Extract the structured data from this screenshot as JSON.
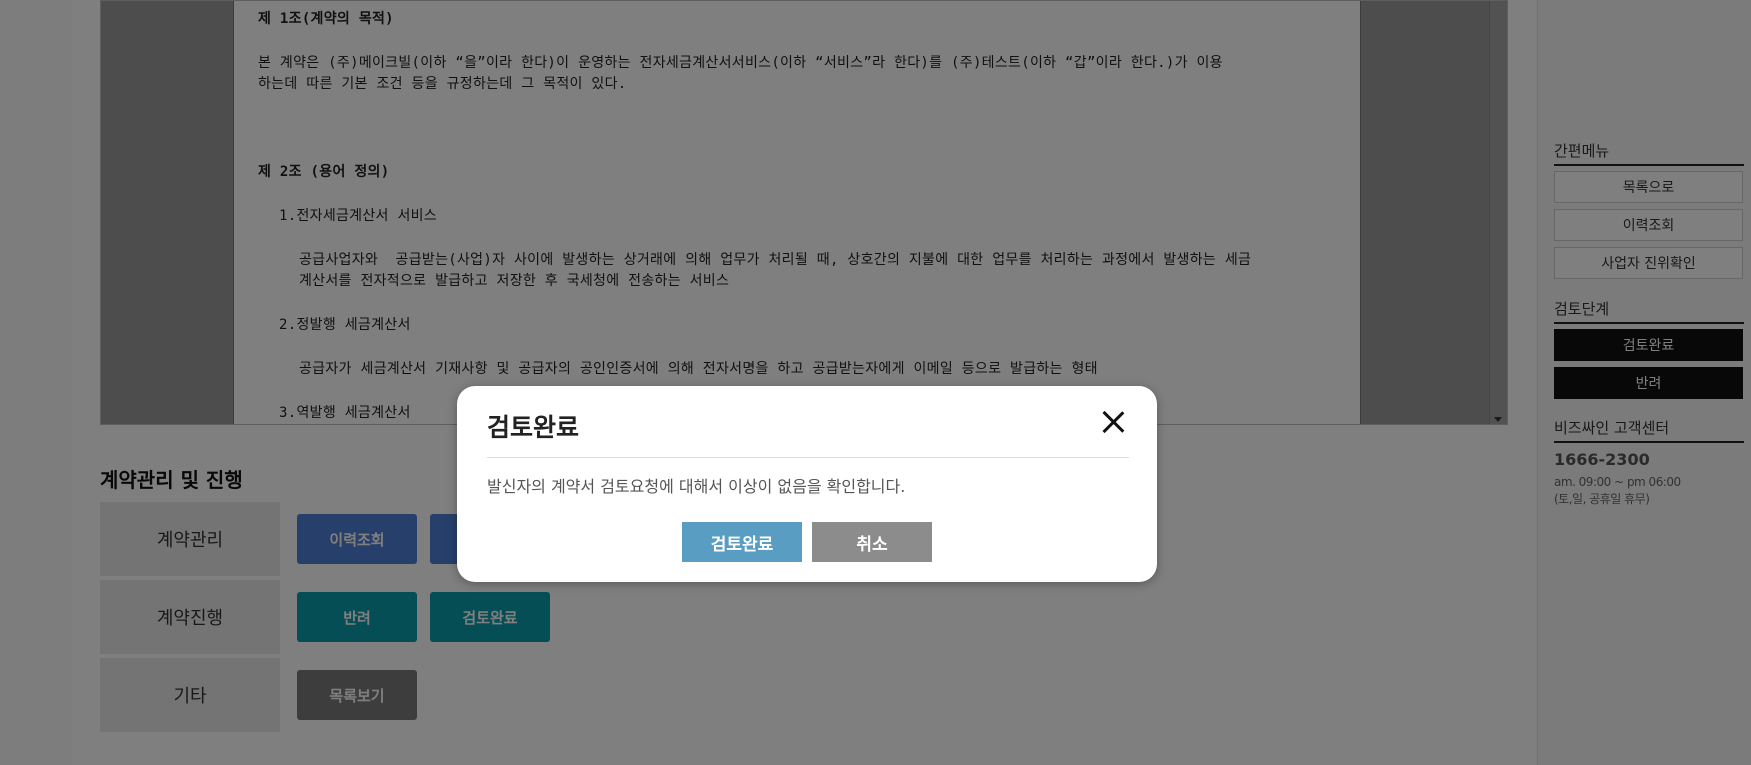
{
  "document": {
    "article1_title": "제 1조(계약의 목적)",
    "article1_line1": "본 계약은 (주)메이크빌(이하 “을”이라 한다)이 운영하는 전자세금계산서서비스(이하 “서비스”라 한다)를 (주)테스트(이하 “갑”이라 한다.)가 이용",
    "article1_line2": "하는데 따른 기본 조건 등을 규정하는데 그 목적이 있다.",
    "article2_title": "제 2조 (용어 정의)",
    "item1_title": "1.전자세금계산서 서비스",
    "item1_line1": "공급사업자와  공급받는(사업)자 사이에 발생하는 상거래에 의해 업무가 처리될 때, 상호간의 지불에 대한 업무를 처리하는 과정에서 발생하는 세금",
    "item1_line2": "계산서를 전자적으로 발급하고 저장한 후 국세청에 전송하는 서비스",
    "item2_title": "2.정발행 세금계산서",
    "item2_line1": "공급자가 세금계산서 기재사항 및 공급자의 공인인증서에 의해 전자서명을 하고 공급받는자에게 이메일 등으로 발급하는 형태",
    "item3_title": "3.역발행 세금계산서"
  },
  "management": {
    "section_title": "계약관리 및 진행",
    "rows": [
      {
        "label": "계약관리",
        "buttons": [
          "이력조회",
          ""
        ]
      },
      {
        "label": "계약진행",
        "buttons": [
          "반려",
          "검토완료"
        ]
      },
      {
        "label": "기타",
        "buttons": [
          "목록보기"
        ]
      }
    ]
  },
  "sidebar": {
    "quick_menu_title": "간편메뉴",
    "quick_menu": [
      "목록으로",
      "이력조회",
      "사업자 진위확인"
    ],
    "review_title": "검토단계",
    "review_buttons": [
      "검토완료",
      "반려"
    ],
    "cs_title": "비즈싸인 고객센터",
    "cs_phone": "1666-2300",
    "cs_hours": "am. 09:00 ~ pm 06:00",
    "cs_closed": "(토,일, 공휴일 휴무)"
  },
  "modal": {
    "title": "검토완료",
    "message": "발신자의 계약서 검토요청에 대해서 이상이 없음을 확인합니다.",
    "confirm_label": "검토완료",
    "cancel_label": "취소"
  },
  "colors": {
    "confirm": "#599dc2",
    "cancel": "#8c8c8c",
    "action_blue": "#4c7fd6",
    "action_teal": "#0a9dab"
  }
}
